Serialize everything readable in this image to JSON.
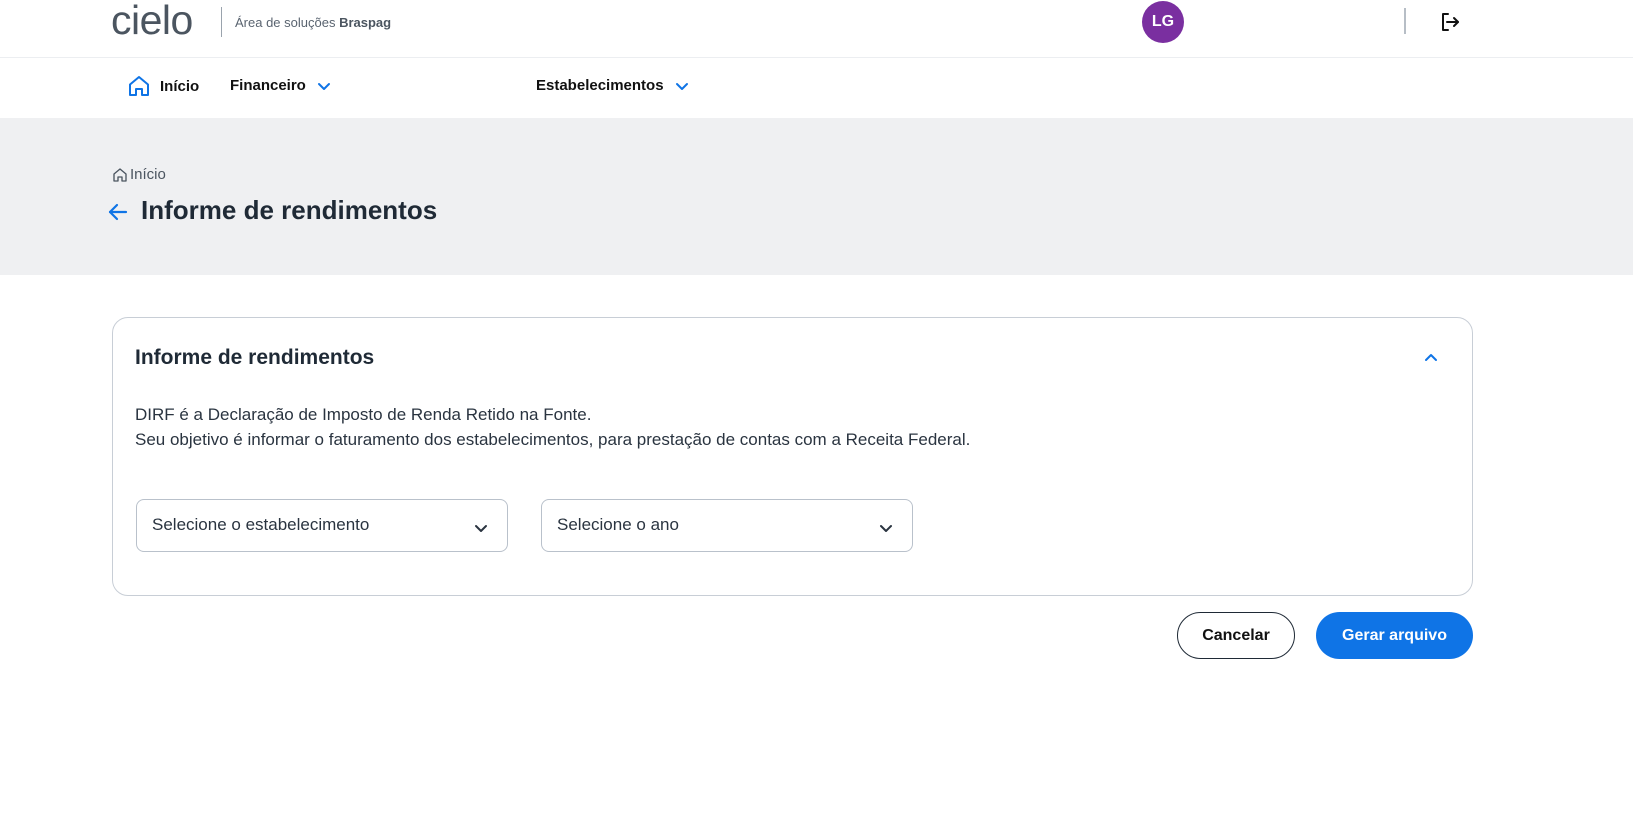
{
  "header": {
    "logo_text": "cielo",
    "area_prefix": "Área de soluções",
    "area_brand": "Braspag",
    "avatar_initials": "LG",
    "avatar_color": "#7a2fa0",
    "logout_icon": "logout-icon"
  },
  "nav": {
    "items": [
      {
        "label": "Início",
        "icon": "home-icon"
      },
      {
        "label": "Financeiro",
        "icon": "chevron-down-icon"
      },
      {
        "label": "Estabelecimentos",
        "icon": "chevron-down-icon"
      }
    ]
  },
  "hero": {
    "breadcrumb": "Início",
    "title": "Informe de rendimentos"
  },
  "card": {
    "title": "Informe de rendimentos",
    "desc_line1": "DIRF é a Declaração de Imposto de Renda Retido na Fonte.",
    "desc_line2": "Seu objetivo é informar o faturamento dos estabelecimentos, para prestação de contas com a Receita Federal.",
    "select_establishment": "Selecione o estabelecimento",
    "select_year": "Selecione o ano"
  },
  "actions": {
    "cancel_label": "Cancelar",
    "generate_label": "Gerar arquivo"
  },
  "colors": {
    "accent": "#0f74e6",
    "hero_bg": "#eff0f2",
    "text": "#1f2a36"
  }
}
